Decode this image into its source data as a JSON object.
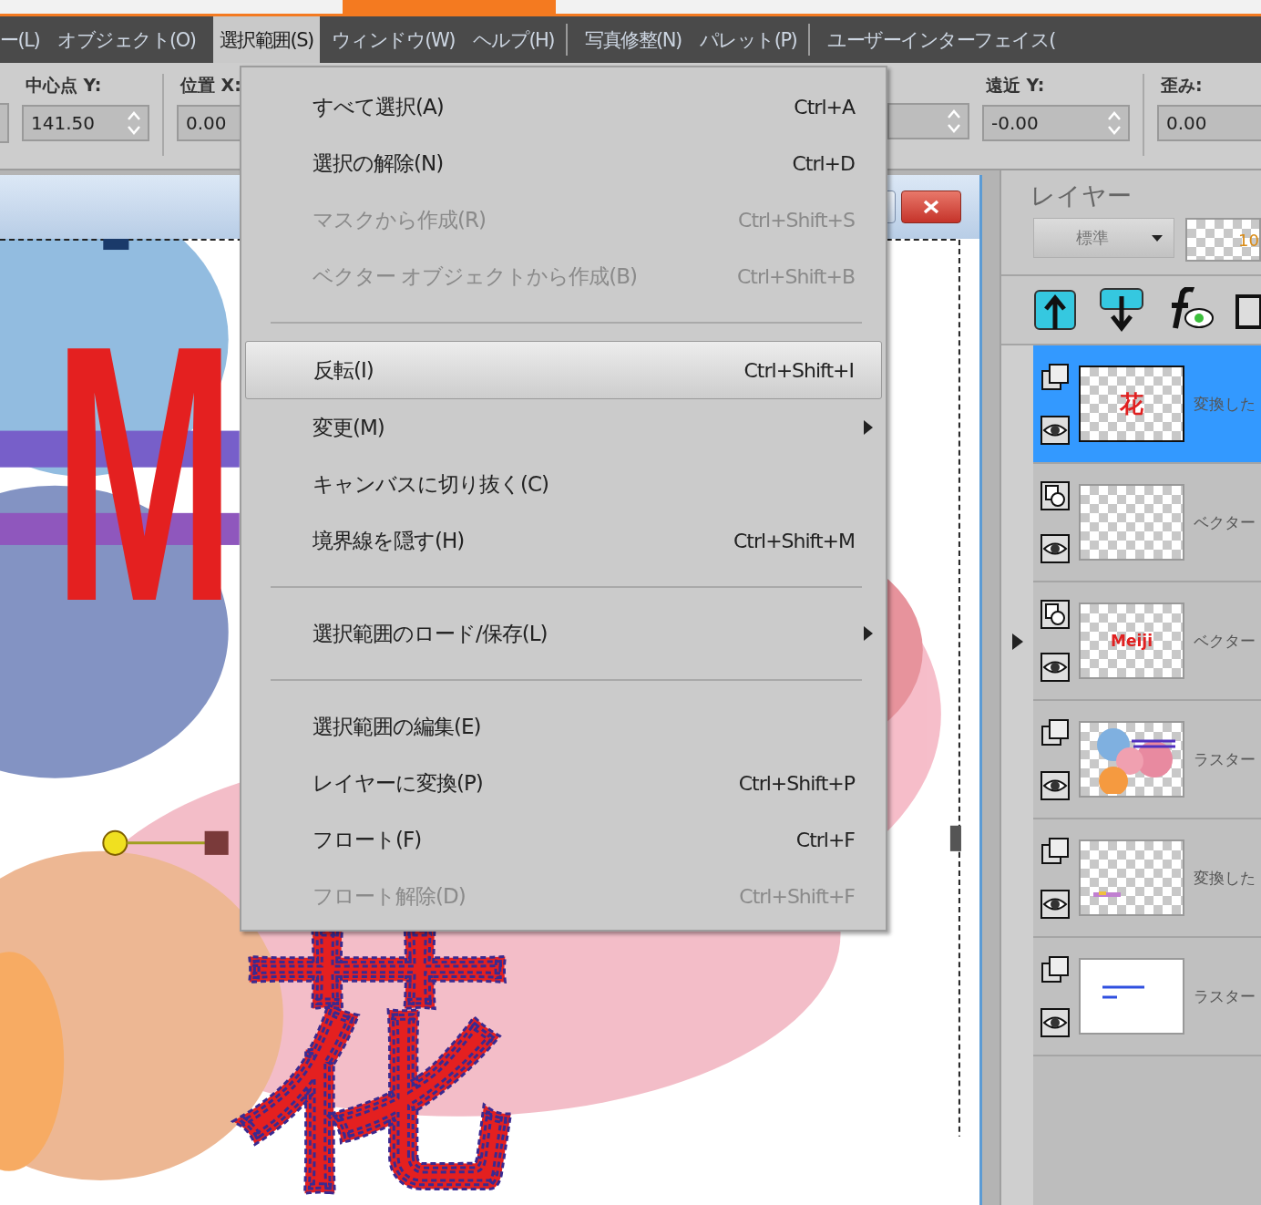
{
  "menu_bar": [
    {
      "kind": "menu",
      "label": "ー(L)",
      "selected": false
    },
    {
      "kind": "menu",
      "label": "オブジェクト(O)",
      "selected": false
    },
    {
      "kind": "menu",
      "label": "選択範囲(S)",
      "selected": true
    },
    {
      "kind": "menu",
      "label": "ウィンドウ(W)",
      "selected": false
    },
    {
      "kind": "menu",
      "label": "ヘルプ(H)",
      "selected": false
    },
    {
      "kind": "separator"
    },
    {
      "kind": "menu",
      "label": "写真修整(N)",
      "selected": false
    },
    {
      "kind": "menu",
      "label": "パレット(P)",
      "selected": false
    },
    {
      "kind": "separator"
    },
    {
      "kind": "menu",
      "label": "ユーザーインターフェイス(",
      "selected": false
    }
  ],
  "toolbar": {
    "left_groups": [
      {
        "label": "中心点 Y:",
        "value": "141.50"
      },
      {
        "label": "位置 X:",
        "value": "0.00"
      }
    ],
    "right_groups": [
      {
        "label": "遠近 Y:",
        "value": "-0.00"
      },
      {
        "label": "歪み:",
        "value": "0.00"
      }
    ]
  },
  "dropdown_menu": [
    {
      "kind": "item",
      "label": "すべて選択(A)",
      "shortcut": "Ctrl+A",
      "disabled": false,
      "selected": false
    },
    {
      "kind": "item",
      "label": "選択の解除(N)",
      "shortcut": "Ctrl+D",
      "disabled": false,
      "selected": false
    },
    {
      "kind": "item",
      "label": "マスクから作成(R)",
      "shortcut": "Ctrl+Shift+S",
      "disabled": true,
      "selected": false
    },
    {
      "kind": "item",
      "label": "ベクター オブジェクトから作成(B)",
      "shortcut": "Ctrl+Shift+B",
      "disabled": true,
      "selected": false
    },
    {
      "kind": "separator"
    },
    {
      "kind": "item",
      "label": "反転(I)",
      "shortcut": "Ctrl+Shift+I",
      "disabled": false,
      "selected": true
    },
    {
      "kind": "submenu",
      "label": "変更(M)",
      "disabled": false,
      "selected": false
    },
    {
      "kind": "item",
      "label": "キャンバスに切り抜く(C)",
      "disabled": false,
      "selected": false
    },
    {
      "kind": "item",
      "label": "境界線を隠す(H)",
      "shortcut": "Ctrl+Shift+M",
      "disabled": false,
      "selected": false
    },
    {
      "kind": "separator"
    },
    {
      "kind": "submenu",
      "label": "選択範囲のロード/保存(L)",
      "disabled": false,
      "selected": false
    },
    {
      "kind": "separator"
    },
    {
      "kind": "item",
      "label": "選択範囲の編集(E)",
      "disabled": false,
      "selected": false
    },
    {
      "kind": "item",
      "label": "レイヤーに変換(P)",
      "shortcut": "Ctrl+Shift+P",
      "disabled": false,
      "selected": false
    },
    {
      "kind": "item",
      "label": "フロート(F)",
      "shortcut": "Ctrl+F",
      "disabled": false,
      "selected": false
    },
    {
      "kind": "item",
      "label": "フロート解除(D)",
      "shortcut": "Ctrl+Shift+F",
      "disabled": true,
      "selected": false
    }
  ],
  "canvas": {
    "letter": "M",
    "character": "花"
  },
  "layers_panel": {
    "title": "レイヤー",
    "blend_mode": "標準",
    "opacity": "10",
    "layers": [
      {
        "kind": "raster",
        "thumbnail": {
          "kind": "text",
          "text": "花"
        },
        "name": "変換した",
        "selected": true,
        "expandable": false
      },
      {
        "kind": "vector",
        "thumbnail": {
          "kind": "blank"
        },
        "name": "ベクター",
        "selected": false,
        "expandable": false
      },
      {
        "kind": "vector",
        "thumbnail": {
          "kind": "text",
          "text": "Meiji"
        },
        "name": "ベクター",
        "selected": false,
        "expandable": true
      },
      {
        "kind": "raster",
        "thumbnail": {
          "kind": "flowers"
        },
        "name": "ラスター",
        "selected": false,
        "expandable": false
      },
      {
        "kind": "raster",
        "thumbnail": {
          "kind": "specks"
        },
        "name": "変換した",
        "selected": false,
        "expandable": false
      },
      {
        "kind": "raster",
        "thumbnail": {
          "kind": "lines"
        },
        "name": "ラスター",
        "selected": false,
        "expandable": false
      }
    ]
  }
}
